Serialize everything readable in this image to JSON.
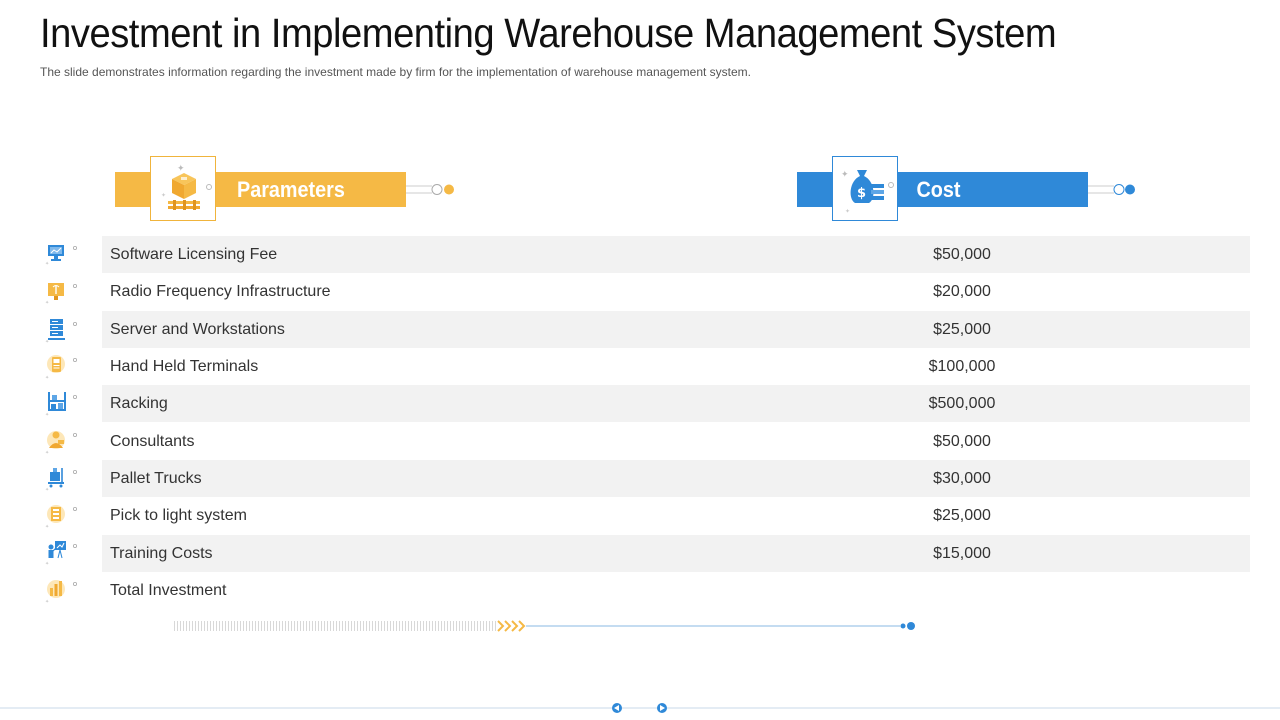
{
  "title": "Investment in Implementing Warehouse Management System",
  "subtitle": "The slide demonstrates information regarding the investment made by firm for the implementation of warehouse management system.",
  "headers": {
    "parameters": "Parameters",
    "cost": "Cost"
  },
  "rows": [
    {
      "parameter": "Software Licensing Fee",
      "cost": "$50,000",
      "icon": "monitor-chart-icon"
    },
    {
      "parameter": "Radio Frequency Infrastructure",
      "cost": "$20,000",
      "icon": "antenna-icon"
    },
    {
      "parameter": "Server and Workstations",
      "cost": "$25,000",
      "icon": "server-icon"
    },
    {
      "parameter": "Hand Held Terminals",
      "cost": "$100,000",
      "icon": "handheld-terminal-icon"
    },
    {
      "parameter": "Racking",
      "cost": "$500,000",
      "icon": "rack-icon"
    },
    {
      "parameter": "Consultants",
      "cost": "$50,000",
      "icon": "consultant-icon"
    },
    {
      "parameter": "Pallet Trucks",
      "cost": "$30,000",
      "icon": "pallet-truck-icon"
    },
    {
      "parameter": "Pick to light system",
      "cost": "$25,000",
      "icon": "light-system-icon"
    },
    {
      "parameter": "Training Costs",
      "cost": "$15,000",
      "icon": "training-icon"
    },
    {
      "parameter": "Total Investment",
      "cost": "",
      "icon": "total-investment-icon"
    }
  ],
  "colors": {
    "accent_orange": "#f5b945",
    "accent_blue": "#2f89d8",
    "row_shade": "#f2f2f2"
  }
}
